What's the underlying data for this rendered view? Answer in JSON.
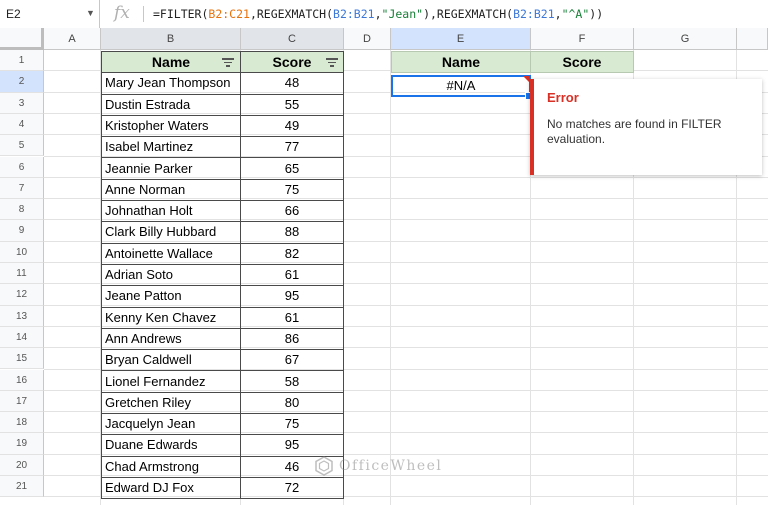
{
  "formula_bar": {
    "cell_ref": "E2",
    "fx": "fx",
    "f_prefix": "=FILTER(",
    "f_ref1": "B2:C21",
    "f_mid1": ",REGEXMATCH(",
    "f_ref2": "B2:B21",
    "f_mid2": ",",
    "f_str1": "\"Jean\"",
    "f_mid3": "),REGEXMATCH(",
    "f_ref3": "B2:B21",
    "f_mid4": ",",
    "f_str2": "\"^A\"",
    "f_suffix": "))"
  },
  "columns": [
    "A",
    "B",
    "C",
    "D",
    "E",
    "F",
    "G"
  ],
  "rows": [
    "1",
    "2",
    "3",
    "4",
    "5",
    "6",
    "7",
    "8",
    "9",
    "10",
    "11",
    "12",
    "13",
    "14",
    "15",
    "16",
    "17",
    "18",
    "19",
    "20",
    "21"
  ],
  "table": {
    "header_name": "Name",
    "header_score": "Score",
    "rows": [
      {
        "name": "Mary Jean Thompson",
        "score": "48"
      },
      {
        "name": "Dustin Estrada",
        "score": "55"
      },
      {
        "name": "Kristopher Waters",
        "score": "49"
      },
      {
        "name": "Isabel Martinez",
        "score": "77"
      },
      {
        "name": "Jeannie Parker",
        "score": "65"
      },
      {
        "name": "Anne Norman",
        "score": "75"
      },
      {
        "name": "Johnathan Holt",
        "score": "66"
      },
      {
        "name": "Clark Billy Hubbard",
        "score": "88"
      },
      {
        "name": "Antoinette Wallace",
        "score": "82"
      },
      {
        "name": "Adrian Soto",
        "score": "61"
      },
      {
        "name": "Jeane Patton",
        "score": "95"
      },
      {
        "name": "Kenny Ken Chavez",
        "score": "61"
      },
      {
        "name": "Ann Andrews",
        "score": "86"
      },
      {
        "name": "Bryan Caldwell",
        "score": "67"
      },
      {
        "name": "Lionel Fernandez",
        "score": "58"
      },
      {
        "name": "Gretchen Riley",
        "score": "80"
      },
      {
        "name": "Jacquelyn Jean",
        "score": "75"
      },
      {
        "name": "Duane Edwards",
        "score": "95"
      },
      {
        "name": "Chad Armstrong",
        "score": "46"
      },
      {
        "name": "Edward DJ Fox",
        "score": "72"
      }
    ]
  },
  "result": {
    "header_name": "Name",
    "header_score": "Score",
    "value": "#N/A"
  },
  "error_popup": {
    "title": "Error",
    "message": "No matches are found in FILTER evaluation."
  },
  "watermark": {
    "text": "OfficeWheel"
  },
  "colors": {
    "header_fill": "#d9ead3",
    "error_red": "#d93025",
    "selection_blue": "#1a73e8"
  }
}
